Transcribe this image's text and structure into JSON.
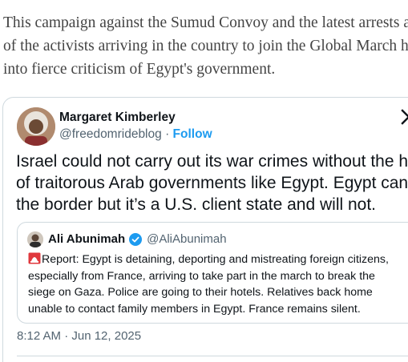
{
  "article": {
    "lines": [
      "This campaign against the Sumud Convoy and the latest arrests and r",
      "of the activists arriving in the country to join the Global March has no",
      "into fierce criticism of Egypt's government."
    ]
  },
  "tweet": {
    "author_name": "Margaret Kimberley",
    "author_handle": "@freedomrideblog",
    "separator": "·",
    "follow_label": "Follow",
    "body_lines": [
      "Israel could not carry out its war crimes without the help",
      "of traitorous Arab governments like Egypt. Egypt can ope",
      "the border but it’s a U.S. client state and will not."
    ],
    "timestamp": "8:12 AM · Jun 12, 2025",
    "quote": {
      "author_name": "Ali Abunimah",
      "author_handle": "@AliAbunimah",
      "verified_icon": "verified-badge-icon",
      "siren_icon": "siren-emoji-icon",
      "body_first_line_text": "Report: Egypt is detaining, deporting and mistreating foreign citizens,",
      "body_lines": [
        "especially from France, arriving to take part in the march to break the",
        "siege on Gaza. Police are going to their hotels. Relatives back home",
        "unable to contact family members in Egypt. France remains silent."
      ]
    }
  },
  "icons": {
    "platform_logo": "x-logo-icon",
    "author_avatar": "avatar",
    "quote_avatar": "avatar"
  },
  "colors": {
    "link_blue": "#1d9bf0",
    "border": "#cfd9de",
    "muted_text": "#536471",
    "primary_text": "#0f1419",
    "article_text": "#444444"
  }
}
